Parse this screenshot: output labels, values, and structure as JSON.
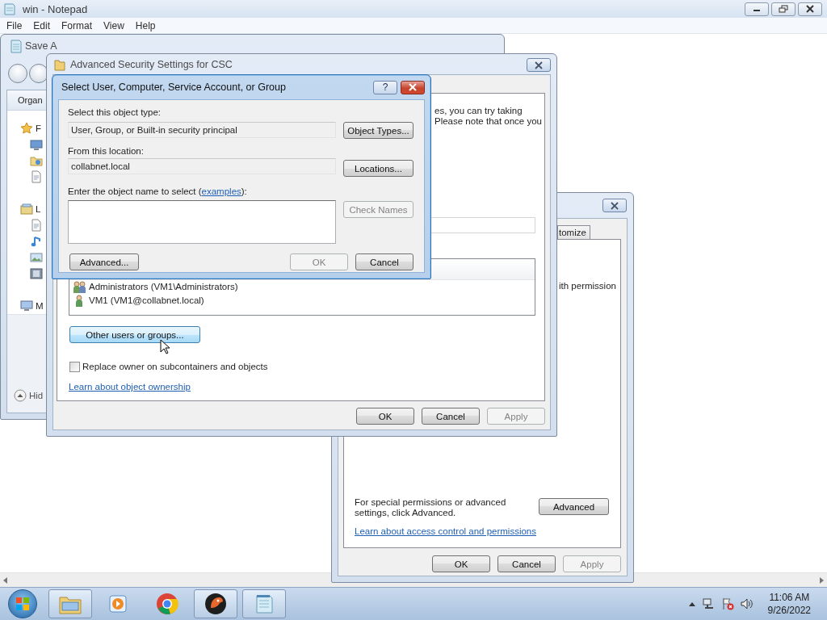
{
  "notepad": {
    "title": "win - Notepad",
    "menu": [
      "File",
      "Edit",
      "Format",
      "View",
      "Help"
    ]
  },
  "save_as": {
    "title": "Save A",
    "toolbar_label": "Organ",
    "sidebar": [
      {
        "label": "F",
        "kind": "star",
        "children": [
          {
            "kind": "monitor"
          },
          {
            "kind": "folder"
          },
          {
            "kind": "document"
          }
        ]
      },
      {
        "label": "L",
        "kind": "library",
        "children": [
          {
            "kind": "document"
          },
          {
            "kind": "music"
          },
          {
            "kind": "picture"
          },
          {
            "kind": "film"
          }
        ]
      },
      {
        "label": "M",
        "kind": "computer"
      }
    ],
    "hide_label": "Hid"
  },
  "advanced_security": {
    "title": "Advanced Security Settings for CSC",
    "note_lines": [
      "es, you can try taking",
      "Please note that once you"
    ],
    "owners": [
      {
        "name": "Administrators (VM1\\Administrators)",
        "kind": "group"
      },
      {
        "name": "VM1 (VM1@collabnet.local)",
        "kind": "user"
      }
    ],
    "other_button": {
      "label": "Other users or groups...",
      "hovered": true
    },
    "replace_owner": {
      "label": "Replace owner on subcontainers and objects",
      "checked": false
    },
    "link": "Learn about object ownership",
    "buttons": [
      {
        "label": "OK",
        "disabled": false
      },
      {
        "label": "Cancel",
        "disabled": false
      },
      {
        "label": "Apply",
        "disabled": true
      }
    ]
  },
  "permissions": {
    "tab": "tomize",
    "partial_text": "ith permission",
    "advanced_note": "For special permissions or advanced settings, click Advanced.",
    "advanced_button": "Advanced",
    "link": "Learn about access control and permissions",
    "buttons": [
      {
        "label": "OK",
        "disabled": false
      },
      {
        "label": "Cancel",
        "disabled": false
      },
      {
        "label": "Apply",
        "disabled": true
      }
    ]
  },
  "select_dialog": {
    "title": "Select User, Computer, Service Account, or Group",
    "help": "?",
    "type_label": "Select this object type:",
    "type_value": "User, Group, or Built-in security principal",
    "type_button": "Object Types...",
    "location_label": "From this location:",
    "location_value": "collabnet.local",
    "location_button": "Locations...",
    "name_label": {
      "before": "Enter the object name to select (",
      "link": "examples",
      "after": "):"
    },
    "check_button": {
      "label": "Check Names",
      "disabled": true
    },
    "advanced_button": "Advanced...",
    "buttons": [
      {
        "label": "OK",
        "disabled": true
      },
      {
        "label": "Cancel",
        "disabled": false
      }
    ]
  },
  "taskbar": {
    "apps": [
      {
        "kind": "explorer",
        "running": true
      },
      {
        "kind": "media",
        "running": false
      },
      {
        "kind": "browser",
        "running": false
      },
      {
        "kind": "bird",
        "running": true
      },
      {
        "kind": "notepad",
        "running": true
      }
    ],
    "time": "11:06 AM",
    "date": "9/26/2022"
  }
}
